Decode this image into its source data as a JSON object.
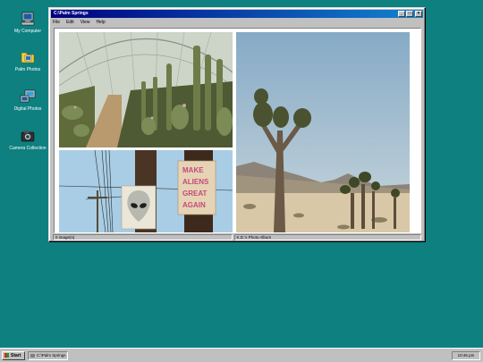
{
  "desktop": {
    "icons": [
      {
        "label": "My Computer",
        "icon": "computer-icon"
      },
      {
        "label": "Palm Photos",
        "icon": "folder-photos-icon"
      },
      {
        "label": "Digital Photos",
        "icon": "network-photos-icon"
      },
      {
        "label": "Camera Collection",
        "icon": "camera-icon"
      }
    ],
    "background_color": "#0e8080"
  },
  "window": {
    "title": "C:\\Palm Springs",
    "menu": [
      "File",
      "Edit",
      "View",
      "Help"
    ],
    "status": {
      "count": "0 image(s)",
      "album": "K.D.'s Photo Album"
    },
    "photos": [
      {
        "name": "greenhouse-cactus-photo"
      },
      {
        "name": "alien-signs-photo",
        "sign_text": [
          "MAKE",
          "ALIENS",
          "GREAT",
          "AGAIN"
        ]
      },
      {
        "name": "joshua-tree-photo"
      }
    ]
  },
  "taskbar": {
    "start_label": "Start",
    "task_label": "C:\\Palm Springs",
    "clock": "10:46 pm"
  },
  "colors": {
    "titlebar_start": "#000080",
    "titlebar_end": "#1084d0",
    "chrome": "#c0c0c0"
  }
}
